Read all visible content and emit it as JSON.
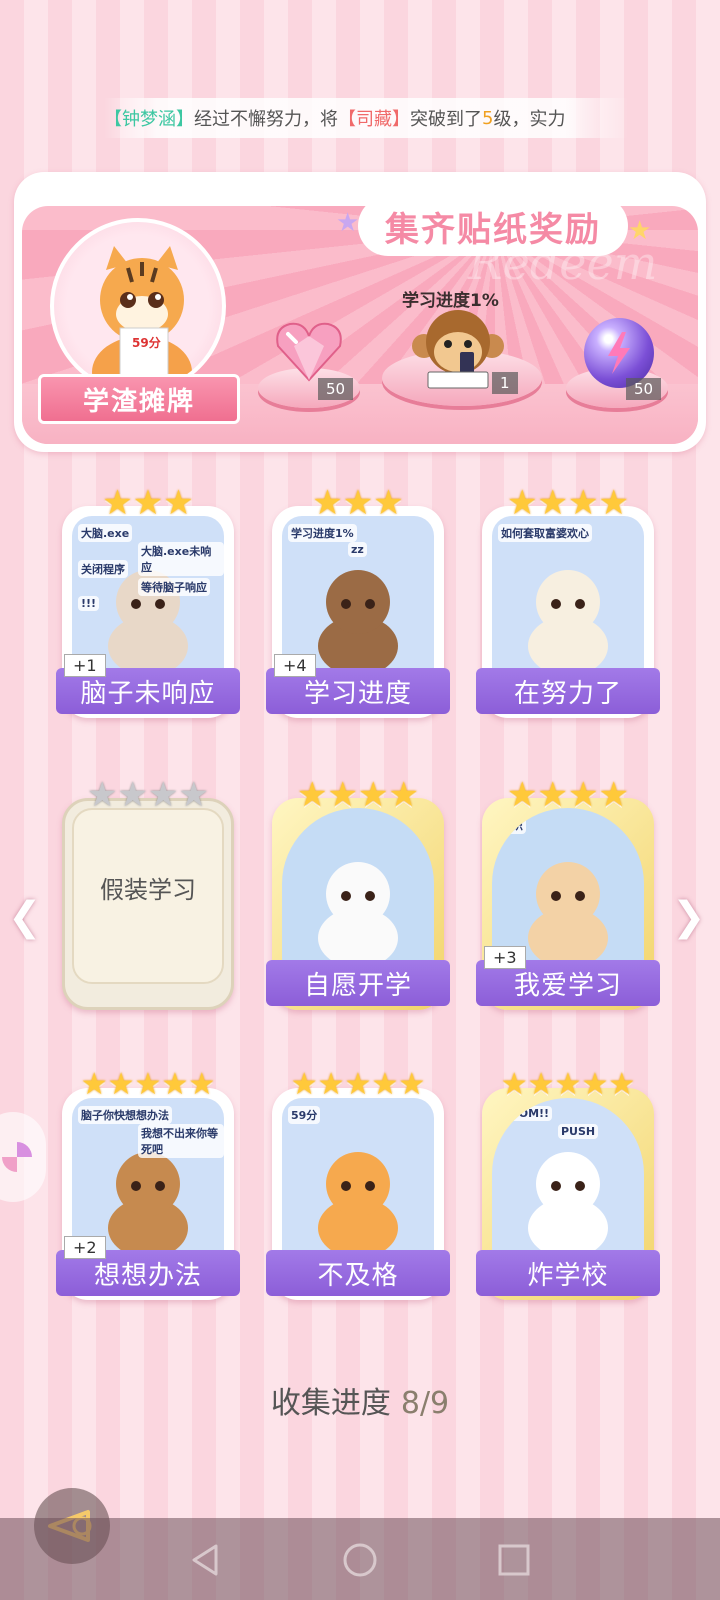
{
  "ticker": {
    "bracket_open": "【",
    "bracket_close": "】",
    "player": "钟梦涵",
    "text1": "经过不懈努力，将",
    "sticker": "司藏",
    "text2": "突破到了",
    "level": "5",
    "text3": "级，实力"
  },
  "reward_panel": {
    "title": "集齐贴纸奖励",
    "watermark": "Redeem",
    "character_name": "学渣摊牌",
    "character_note": "59分",
    "featured_caption": "学习进度1%",
    "rewards": [
      {
        "icon": "heart-gem-icon",
        "count": "50"
      },
      {
        "icon": "monkey-phone-icon",
        "count": "1"
      },
      {
        "icon": "lightning-orb-icon",
        "count": "50"
      }
    ]
  },
  "stickers": [
    {
      "label": "脑子未响应",
      "stars": 3,
      "badge": "+1",
      "art_text": [
        "大脑.exe",
        "大脑.exe未响应",
        "关闭程序",
        "等待脑子响应",
        "!!!"
      ],
      "locked": false
    },
    {
      "label": "学习进度",
      "stars": 3,
      "badge": "+4",
      "art_text": [
        "学习进度1%",
        "zz"
      ],
      "locked": false
    },
    {
      "label": "在努力了",
      "stars": 4,
      "badge": "",
      "art_text": [
        "如何套取富婆欢心"
      ],
      "locked": false
    },
    {
      "label": "假装学习",
      "stars": 4,
      "badge": "",
      "art_text": [],
      "locked": true
    },
    {
      "label": "自愿开学",
      "stars": 4,
      "badge": "",
      "art_text": [],
      "locked": false
    },
    {
      "label": "我爱学习",
      "stars": 4,
      "badge": "+3",
      "art_text": [
        "知识"
      ],
      "locked": false
    },
    {
      "label": "想想办法",
      "stars": 5,
      "badge": "+2",
      "art_text": [
        "脑子你快想想办法",
        "我想不出来你等死吧"
      ],
      "locked": false
    },
    {
      "label": "不及格",
      "stars": 5,
      "badge": "",
      "art_text": [
        "59分"
      ],
      "locked": false
    },
    {
      "label": "炸学校",
      "stars": 5,
      "badge": "",
      "art_text": [
        "BOOM!!",
        "PUSH"
      ],
      "locked": false
    }
  ],
  "collection": {
    "label": "收集进度",
    "value": "8/9"
  },
  "colors": {
    "accent_purple": "#8c5ed8",
    "pink": "#f58aa5",
    "star_gold": "#ffc93a"
  }
}
